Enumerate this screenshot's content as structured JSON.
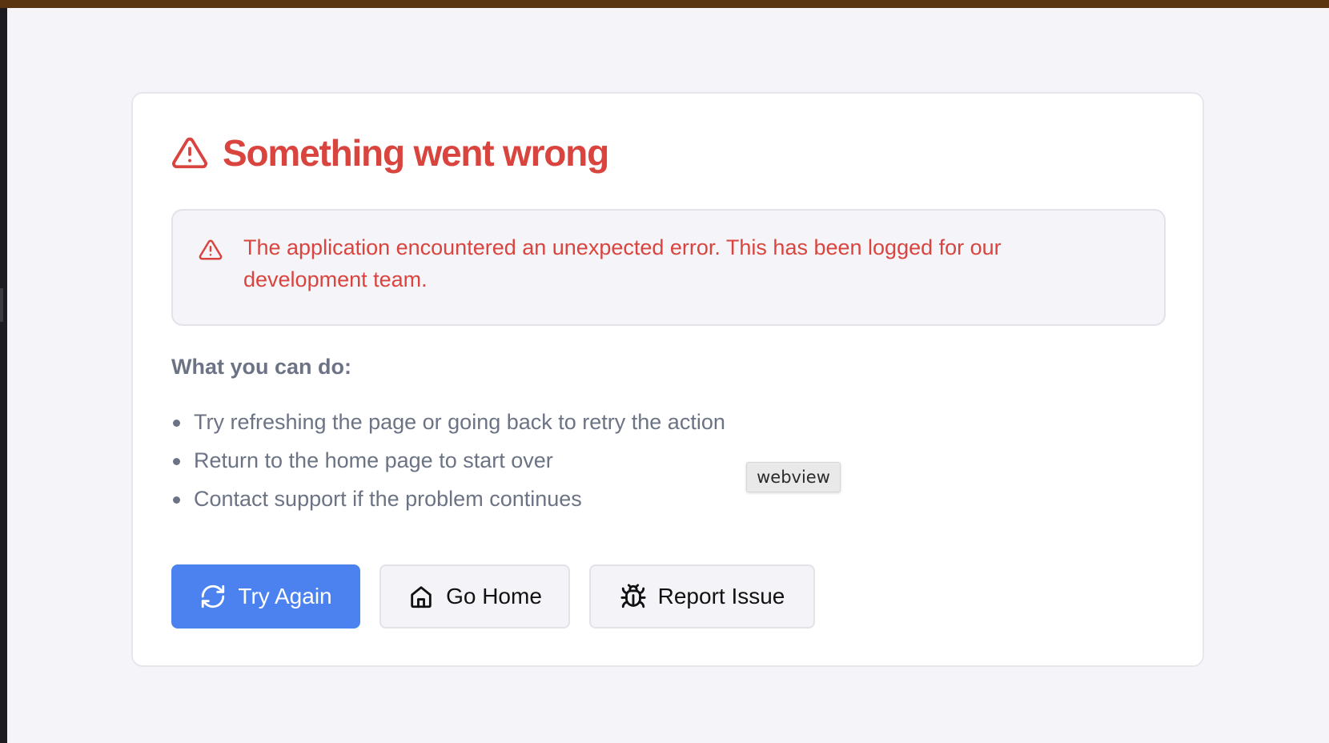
{
  "colors": {
    "error_red": "#d9453e",
    "primary_blue": "#4c82ef",
    "muted_text": "#6b7385",
    "page_background": "#f5f5f9",
    "top_bar": "#5a3411"
  },
  "error_card": {
    "title": "Something went wrong",
    "title_icon": "warning-triangle-icon",
    "alert": {
      "icon": "warning-triangle-icon",
      "message": "The application encountered an unexpected error. This has been logged for our development team."
    },
    "suggestions_heading": "What you can do:",
    "suggestions": [
      "Try refreshing the page or going back to retry the action",
      "Return to the home page to start over",
      "Contact support if the problem continues"
    ],
    "actions": {
      "try_again": {
        "label": "Try Again",
        "icon": "refresh-icon"
      },
      "go_home": {
        "label": "Go Home",
        "icon": "home-icon"
      },
      "report_issue": {
        "label": "Report Issue",
        "icon": "bug-icon"
      }
    }
  },
  "tooltip": {
    "text": "webview"
  }
}
